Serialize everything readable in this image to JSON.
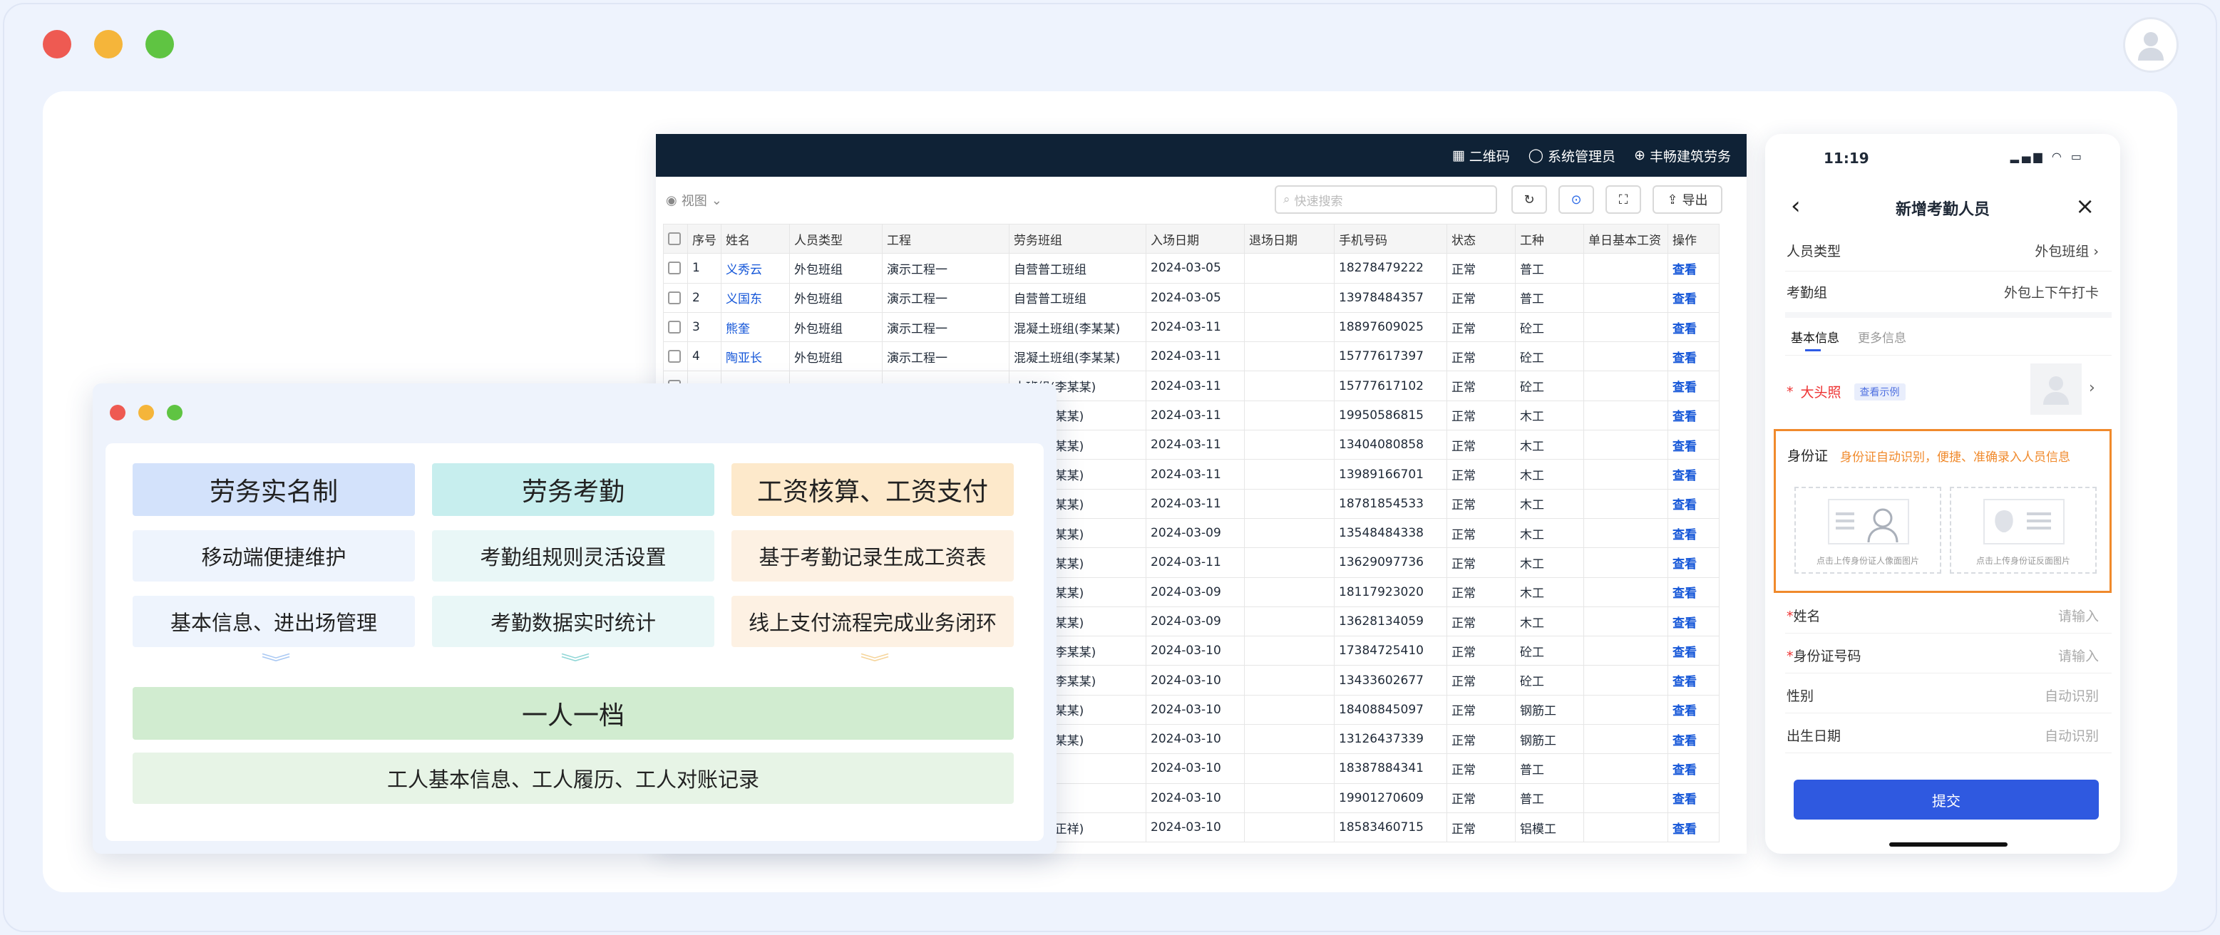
{
  "window": {
    "traffic_colors": [
      "#ee5a52",
      "#f5b53a",
      "#5fc442"
    ]
  },
  "table_window": {
    "topbar": {
      "qr": "二维码",
      "admin": "系统管理员",
      "company": "丰畅建筑劳务"
    },
    "toolbar": {
      "view": "视图",
      "search_placeholder": "快速搜索",
      "export": "导出"
    },
    "columns": [
      "序号",
      "姓名",
      "人员类型",
      "工程",
      "劳务班组",
      "入场日期",
      "退场日期",
      "手机号码",
      "状态",
      "工种",
      "单日基本工资",
      "操作"
    ],
    "rows": [
      [
        "1",
        "义秀云",
        "外包班组",
        "演示工程一",
        "自营普工班组",
        "2024-03-05",
        "",
        "18278479222",
        "正常",
        "普工",
        "",
        "查看"
      ],
      [
        "2",
        "义国东",
        "外包班组",
        "演示工程一",
        "自营普工班组",
        "2024-03-05",
        "",
        "13978484357",
        "正常",
        "普工",
        "",
        "查看"
      ],
      [
        "3",
        "熊奎",
        "外包班组",
        "演示工程一",
        "混凝土班组(李某某)",
        "2024-03-11",
        "",
        "18897609025",
        "正常",
        "砼工",
        "",
        "查看"
      ],
      [
        "4",
        "陶亚长",
        "外包班组",
        "演示工程一",
        "混凝土班组(李某某)",
        "2024-03-11",
        "",
        "15777617397",
        "正常",
        "砼工",
        "",
        "查看"
      ],
      [
        "",
        "",
        "",
        "",
        "土班组(李某某)",
        "2024-03-11",
        "",
        "15777617102",
        "正常",
        "砼工",
        "",
        "查看"
      ],
      [
        "",
        "",
        "",
        "",
        "班组(刘某某)",
        "2024-03-11",
        "",
        "19950586815",
        "正常",
        "木工",
        "",
        "查看"
      ],
      [
        "",
        "",
        "",
        "",
        "班组(刘某某)",
        "2024-03-11",
        "",
        "13404080858",
        "正常",
        "木工",
        "",
        "查看"
      ],
      [
        "",
        "",
        "",
        "",
        "班组(刘某某)",
        "2024-03-11",
        "",
        "13989166701",
        "正常",
        "木工",
        "",
        "查看"
      ],
      [
        "",
        "",
        "",
        "",
        "班组(刘某某)",
        "2024-03-11",
        "",
        "18781854533",
        "正常",
        "木工",
        "",
        "查看"
      ],
      [
        "",
        "",
        "",
        "",
        "班组(刘某某)",
        "2024-03-09",
        "",
        "13548484338",
        "正常",
        "木工",
        "",
        "查看"
      ],
      [
        "",
        "",
        "",
        "",
        "班组(刘某某)",
        "2024-03-11",
        "",
        "13629097736",
        "正常",
        "木工",
        "",
        "查看"
      ],
      [
        "",
        "",
        "",
        "",
        "班组(刘某某)",
        "2024-03-09",
        "",
        "18117923020",
        "正常",
        "木工",
        "",
        "查看"
      ],
      [
        "",
        "",
        "",
        "",
        "班组(刘某某)",
        "2024-03-09",
        "",
        "13628134059",
        "正常",
        "木工",
        "",
        "查看"
      ],
      [
        "",
        "",
        "",
        "",
        "土班组(李某某)",
        "2024-03-10",
        "",
        "17384725410",
        "正常",
        "砼工",
        "",
        "查看"
      ],
      [
        "",
        "",
        "",
        "",
        "土班组(李某某)",
        "2024-03-10",
        "",
        "13433602677",
        "正常",
        "砼工",
        "",
        "查看"
      ],
      [
        "",
        "",
        "",
        "",
        "班组(罗某某)",
        "2024-03-10",
        "",
        "18408845097",
        "正常",
        "钢筋工",
        "",
        "查看"
      ],
      [
        "",
        "",
        "",
        "",
        "班组(罗某某)",
        "2024-03-10",
        "",
        "13126437339",
        "正常",
        "钢筋工",
        "",
        "查看"
      ],
      [
        "",
        "",
        "",
        "",
        "",
        "2024-03-10",
        "",
        "18387884341",
        "正常",
        "普工",
        "",
        "查看"
      ],
      [
        "",
        "",
        "",
        "",
        "",
        "2024-03-10",
        "",
        "19901270609",
        "正常",
        "普工",
        "",
        "查看"
      ],
      [
        "",
        "",
        "",
        "",
        "班组(孙正祥)",
        "2024-03-10",
        "",
        "18583460715",
        "正常",
        "铝模工",
        "",
        "查看"
      ]
    ]
  },
  "feature_card": {
    "dots": [
      "#ee5a52",
      "#f5b53a",
      "#5fc442"
    ],
    "headers": [
      "劳务实名制",
      "劳务考勤",
      "工资核算、工资支付"
    ],
    "row2": [
      "移动端便捷维护",
      "考勤组规则灵活设置",
      "基于考勤记录生成工资表"
    ],
    "row3": [
      "基本信息、进出场管理",
      "考勤数据实时统计",
      "线上支付流程完成业务闭环"
    ],
    "archive_title": "一人一档",
    "archive_desc": "工人基本信息、工人履历、工人对账记录"
  },
  "phone": {
    "time": "11:19",
    "title": "新增考勤人员",
    "person_type_label": "人员类型",
    "person_type_value": "外包班组",
    "group_label": "考勤组",
    "group_value": "外包上下午打卡",
    "tabs": [
      "基本信息",
      "更多信息"
    ],
    "photo_label": "大头照",
    "photo_example": "查看示例",
    "id_label": "身份证",
    "id_hint": "身份证自动识别，便捷、准确录入人员信息",
    "upload_front": "点击上传身份证人像面图片",
    "upload_back": "点击上传身份证反面图片",
    "name_label": "姓名",
    "name_placeholder": "请输入",
    "idno_label": "身份证号码",
    "idno_placeholder": "请输入",
    "gender_label": "性别",
    "gender_value": "自动识别",
    "birth_label": "出生日期",
    "birth_value": "自动识别",
    "submit": "提交"
  }
}
